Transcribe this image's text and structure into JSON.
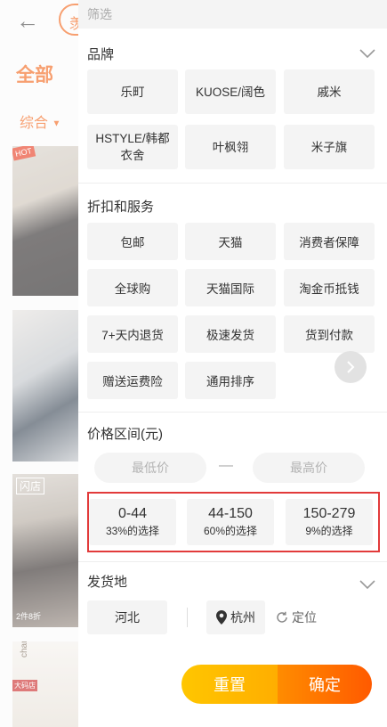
{
  "background": {
    "back_icon": "←",
    "tag_text": "羡",
    "tab_all": "全部",
    "sort_label": "综合",
    "sort_arrow": "▼",
    "hot_badge": "HOT",
    "thumb3_top": "闪店",
    "thumb3_caption": "2件8折",
    "thumb4_text": "change desire",
    "thumb4_badge": "大码店"
  },
  "panel": {
    "title": "筛选",
    "brand": {
      "title": "品牌",
      "items": [
        "乐町",
        "KUOSE/阔色",
        "戚米",
        "HSTYLE/韩都衣舍",
        "叶枫翎",
        "米子旗"
      ]
    },
    "services": {
      "title": "折扣和服务",
      "items": [
        "包邮",
        "天猫",
        "消费者保障",
        "全球购",
        "天猫国际",
        "淘金币抵钱",
        "7+天内退货",
        "极速发货",
        "货到付款",
        "赠送运费险",
        "通用排序"
      ]
    },
    "price": {
      "title": "价格区间(元)",
      "min_placeholder": "最低价",
      "max_placeholder": "最高价",
      "separator": "—",
      "ranges": [
        {
          "range": "0-44",
          "percent": "33%的选择"
        },
        {
          "range": "44-150",
          "percent": "60%的选择"
        },
        {
          "range": "150-279",
          "percent": "9%的选择"
        }
      ]
    },
    "location": {
      "title": "发货地",
      "items": [
        "河北",
        "杭州"
      ],
      "locate_label": "定位"
    },
    "buttons": {
      "reset": "重置",
      "confirm": "确定"
    }
  },
  "colors": {
    "accent": "#f36c24",
    "highlight_border": "#e23a3a",
    "reset_gradient": "#ffc600",
    "confirm_gradient": "#ff5a00"
  }
}
